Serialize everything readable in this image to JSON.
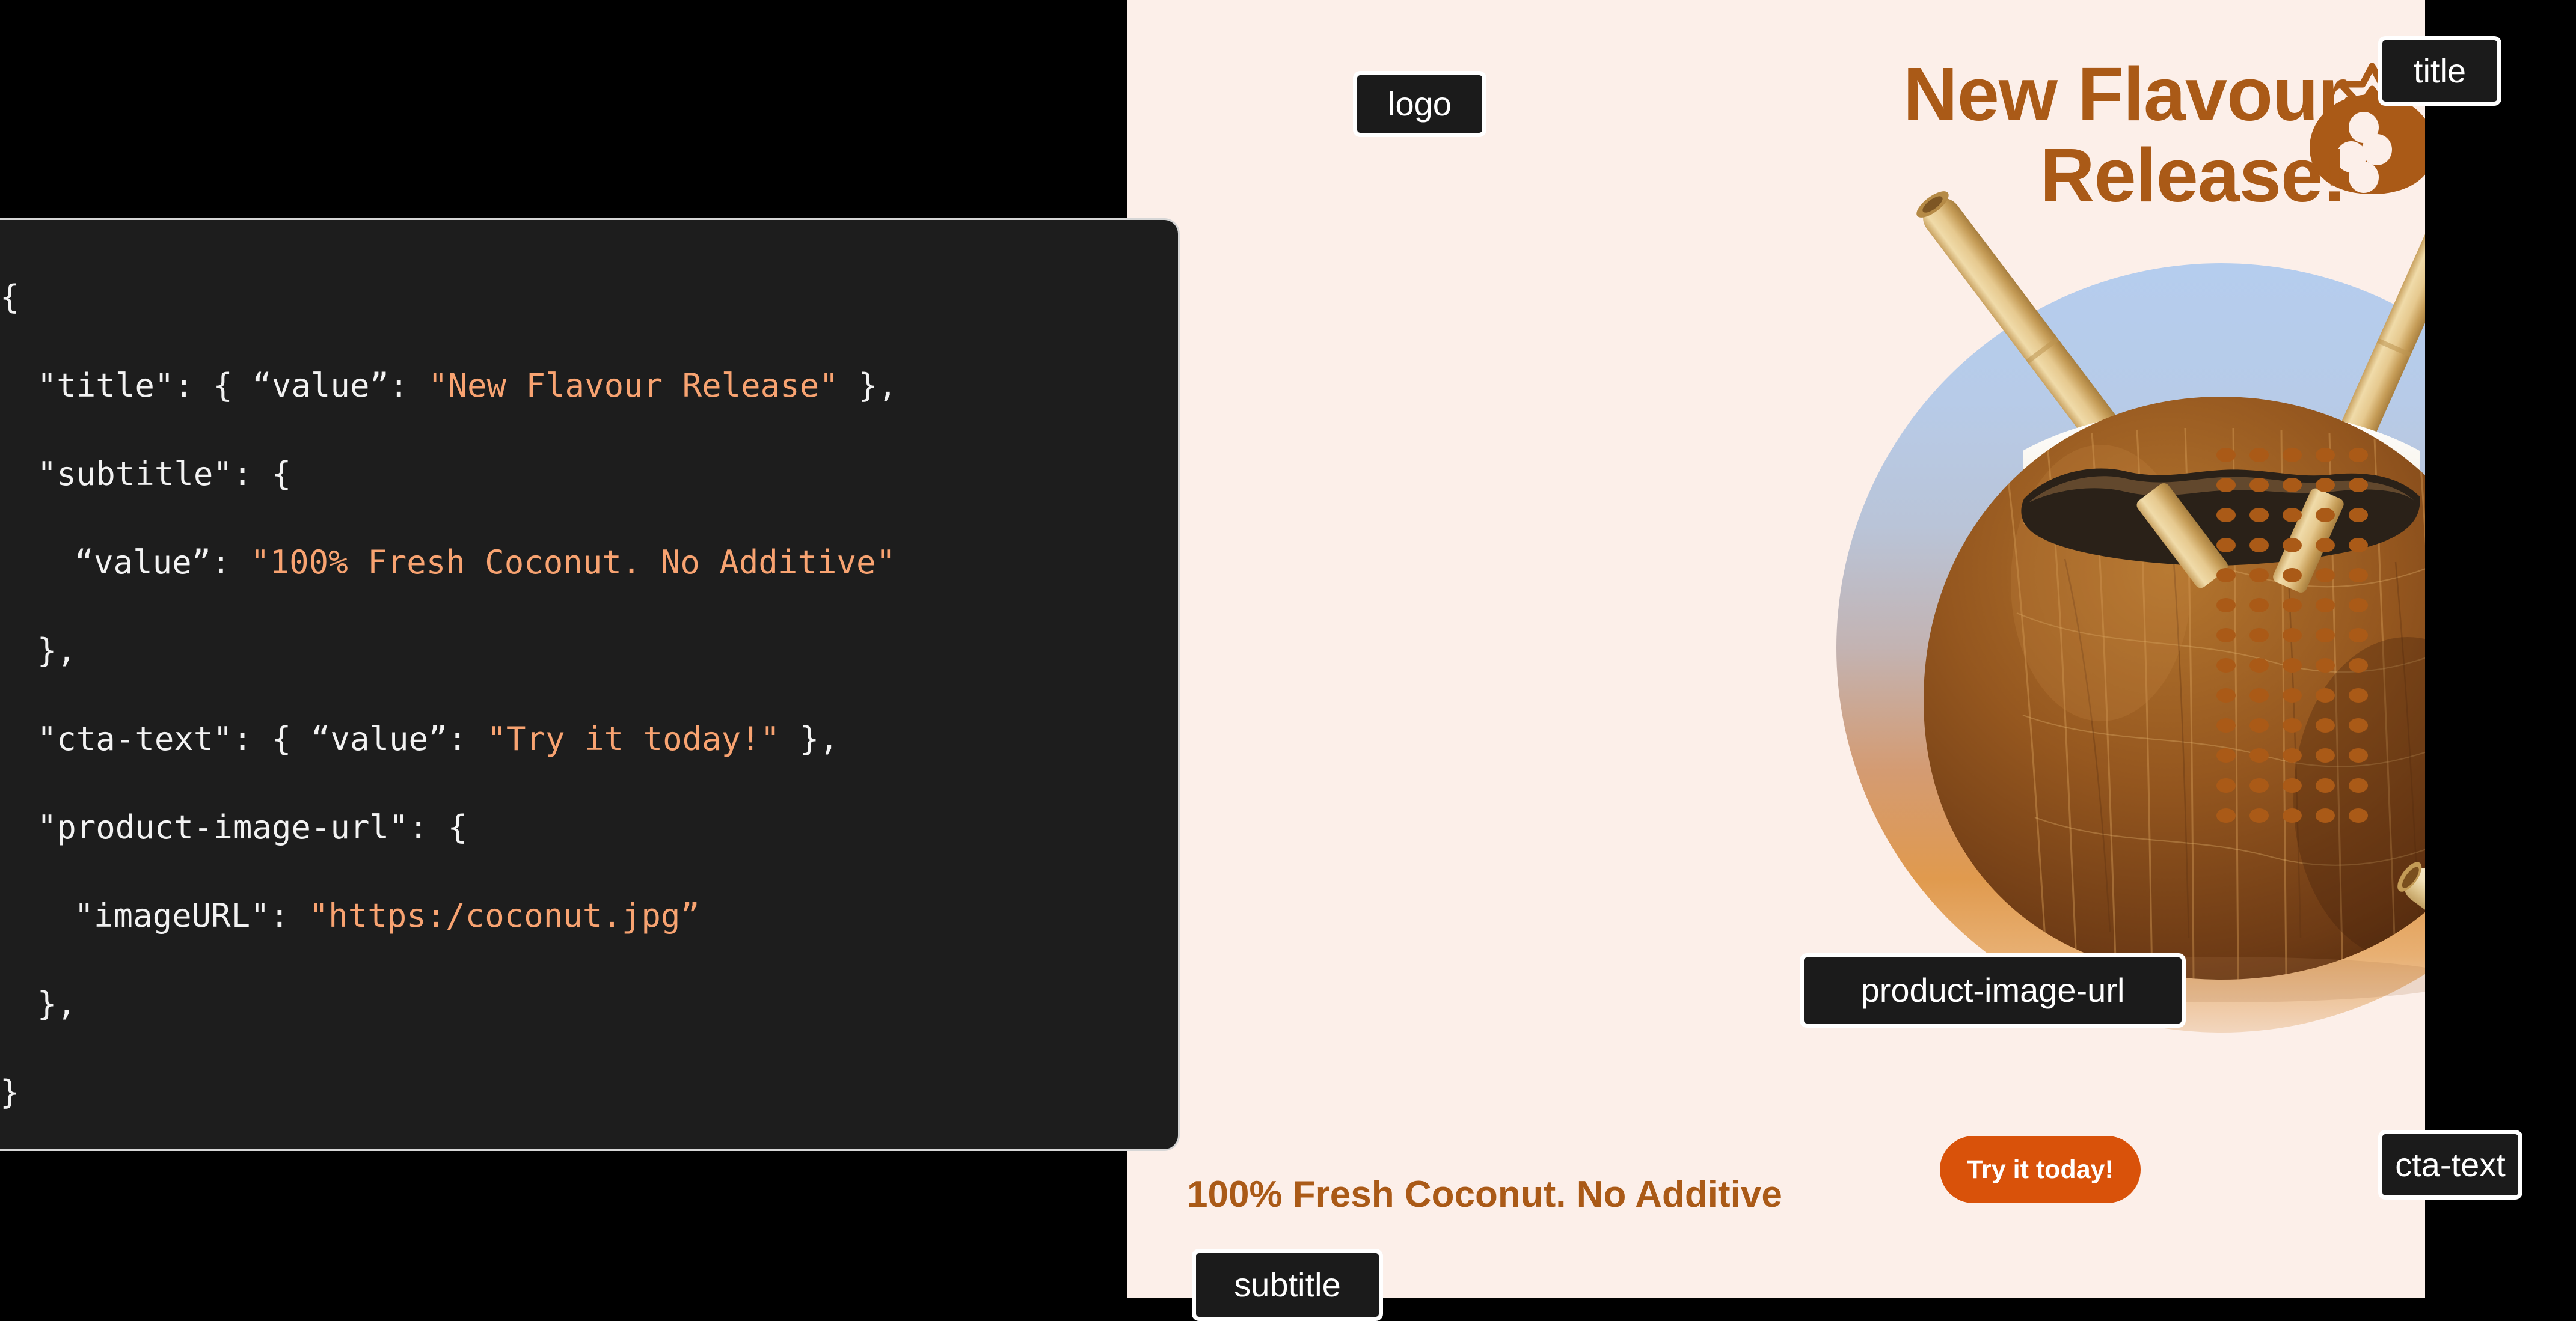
{
  "canvas": {
    "background_color": "#fcefe9",
    "logo": {
      "icon": "coconut-fruit-logo-icon",
      "color": "#aa5a17",
      "seed_color": "#fcefe9"
    },
    "headline": {
      "text": "New Flavour Release!",
      "color": "#aa5a17"
    },
    "subtitle": {
      "text": "100% Fresh Coconut. No Additive",
      "color": "#aa5a17"
    },
    "cta": {
      "label": "Try it today!",
      "background_color": "#d9520a",
      "text_color": "#ffffff"
    },
    "product_image": {
      "alt": "coconut drink with two bamboo straws",
      "backdrop": "circular gradient blue to orange"
    },
    "dot_grid": {
      "columns": 5,
      "rows": 13,
      "color": "#aa5a17"
    }
  },
  "annotations": {
    "logo": "logo",
    "title": "title",
    "subtitle": "subtitle",
    "cta_text": "cta-text",
    "product_image_url": "product-image-url",
    "badge_bg": "#1b1b1b",
    "badge_border": "#ffffff"
  },
  "code_panel": {
    "background_color": "#1d1d1d",
    "text_color": "#f2f2f2",
    "string_color": "#f8a371",
    "lines": [
      {
        "indent": 0,
        "plain": "{"
      },
      {
        "indent": 1,
        "plain": "\"title\": { “value”: ",
        "string": "\"New Flavour Release\"",
        "tail": " },"
      },
      {
        "indent": 1,
        "plain": "\"subtitle\": {"
      },
      {
        "indent": 2,
        "plain": "“value”: ",
        "string": "\"100% Fresh Coconut. No Additive\"",
        "tail": ""
      },
      {
        "indent": 1,
        "plain": "},"
      },
      {
        "indent": 1,
        "plain": "\"cta-text\": { “value”: ",
        "string": "\"Try it today!\"",
        "tail": " },"
      },
      {
        "indent": 1,
        "plain": "\"product-image-url\": {"
      },
      {
        "indent": 2,
        "plain": "\"imageURL\": ",
        "string": "\"https:/coconut.jpg”",
        "tail": ""
      },
      {
        "indent": 1,
        "plain": "},"
      },
      {
        "indent": 0,
        "plain": "}"
      }
    ]
  }
}
